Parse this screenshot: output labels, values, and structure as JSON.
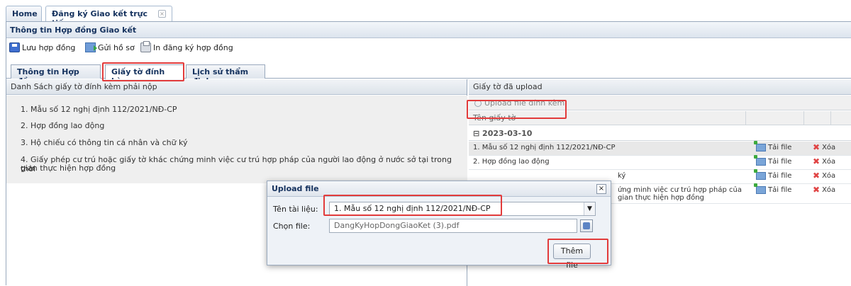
{
  "top_tabs": [
    {
      "label": "Home"
    },
    {
      "label": "Đăng ký Giao kết trực tiếp",
      "close": "×"
    }
  ],
  "frame_title": "Thông tin Hợp đồng Giao kết",
  "toolbar": {
    "save_label": "Lưu hợp đồng",
    "send_label": "Gửi hồ sơ",
    "print_label": "In đăng ký hợp đồng"
  },
  "sub_tabs": [
    {
      "label": "Thông tin Hợp đồng"
    },
    {
      "label": "Giấy tờ đính kèm"
    },
    {
      "label": "Lịch sử thẩm định"
    }
  ],
  "left_panel": {
    "title": "Danh Sách giấy tờ đính kèm phải nộp",
    "items": [
      "1. Mẫu số 12 nghị định 112/2021/NĐ-CP",
      "2. Hợp đồng lao động",
      "3. Hộ chiếu có thông tin cá nhân và chữ ký",
      "4. Giấy phép cư trú hoặc giấy tờ khác chứng minh việc cư trú hợp pháp của người lao động ở nước sở tại trong thời",
      "gian thực hiện hợp đồng"
    ]
  },
  "right_panel": {
    "title": "Giấy tờ đã upload",
    "upload_label": "Upload file đính kèm",
    "col_name": "Tên giấy tờ",
    "group": "⊟ 2023-03-10",
    "rows": [
      {
        "name": "1. Mẫu số 12 nghị định 112/2021/NĐ-CP",
        "download": "Tải file",
        "delete": "Xóa"
      },
      {
        "name": "2. Hợp đồng lao động",
        "download": "Tải file",
        "delete": "Xóa"
      },
      {
        "name": "ký",
        "download": "Tải file",
        "delete": "Xóa"
      },
      {
        "name": "ứng minh việc cư trú hợp pháp của",
        "name2": "gian thực hiện hợp đồng",
        "download": "Tải file",
        "delete": "Xóa"
      }
    ]
  },
  "dialog": {
    "title": "Upload file",
    "close": "×",
    "doc_label": "Tên tài liệu:",
    "doc_value": "1. Mẫu số 12 nghị định 112/2021/NĐ-CP",
    "file_label": "Chọn file:",
    "file_value": "DangKyHopDongGiaoKet (3).pdf",
    "add_button": "Thêm file"
  },
  "colors": {
    "highlight_box": "#e23b3b",
    "header_text": "#15325e"
  }
}
